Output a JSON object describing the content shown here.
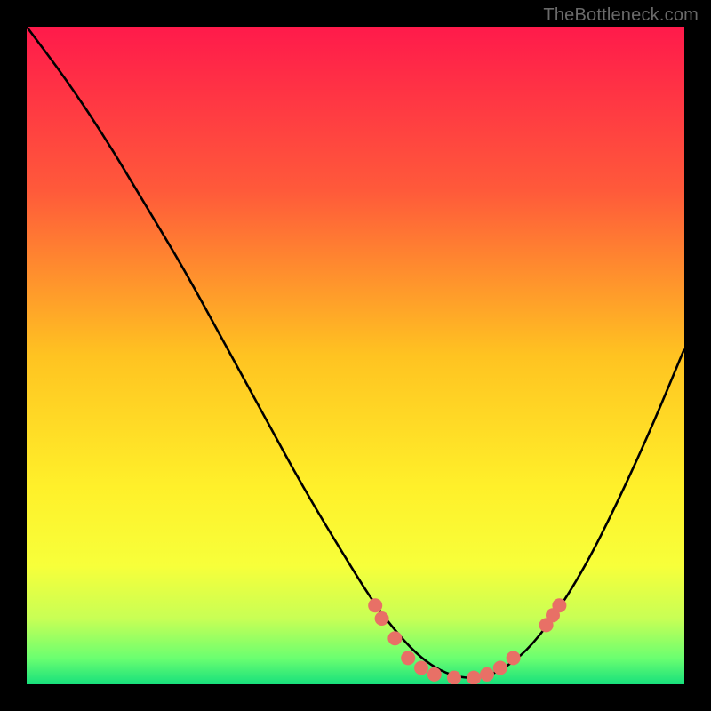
{
  "watermark": "TheBottleneck.com",
  "chart_data": {
    "type": "line",
    "title": "",
    "xlabel": "",
    "ylabel": "",
    "xlim": [
      0,
      100
    ],
    "ylim": [
      0,
      100
    ],
    "grid": false,
    "background": {
      "type": "vertical-gradient",
      "stops": [
        {
          "pos": 0.0,
          "color": "#ff1a4b"
        },
        {
          "pos": 0.25,
          "color": "#ff5a3a"
        },
        {
          "pos": 0.5,
          "color": "#ffc321"
        },
        {
          "pos": 0.7,
          "color": "#fff02a"
        },
        {
          "pos": 0.82,
          "color": "#f7ff3a"
        },
        {
          "pos": 0.9,
          "color": "#c8ff55"
        },
        {
          "pos": 0.96,
          "color": "#6bff70"
        },
        {
          "pos": 1.0,
          "color": "#17e07c"
        }
      ]
    },
    "series": [
      {
        "name": "bottleneck-curve",
        "color": "#000000",
        "x": [
          0,
          6,
          12,
          18,
          24,
          30,
          36,
          42,
          48,
          53,
          57,
          60,
          63,
          66,
          69,
          72,
          76,
          80,
          85,
          90,
          95,
          100
        ],
        "y": [
          100,
          92,
          83,
          73,
          63,
          52,
          41,
          30,
          20,
          12,
          7,
          4,
          2,
          1,
          1,
          2,
          5,
          10,
          18,
          28,
          39,
          51
        ]
      }
    ],
    "points": {
      "name": "highlight-dots",
      "color": "#e87066",
      "radius": 8,
      "data": [
        {
          "x": 53,
          "y": 12
        },
        {
          "x": 54,
          "y": 10
        },
        {
          "x": 56,
          "y": 7
        },
        {
          "x": 58,
          "y": 4
        },
        {
          "x": 60,
          "y": 2.5
        },
        {
          "x": 62,
          "y": 1.5
        },
        {
          "x": 65,
          "y": 1
        },
        {
          "x": 68,
          "y": 1
        },
        {
          "x": 70,
          "y": 1.5
        },
        {
          "x": 72,
          "y": 2.5
        },
        {
          "x": 74,
          "y": 4
        },
        {
          "x": 79,
          "y": 9
        },
        {
          "x": 80,
          "y": 10.5
        },
        {
          "x": 81,
          "y": 12
        }
      ]
    }
  }
}
